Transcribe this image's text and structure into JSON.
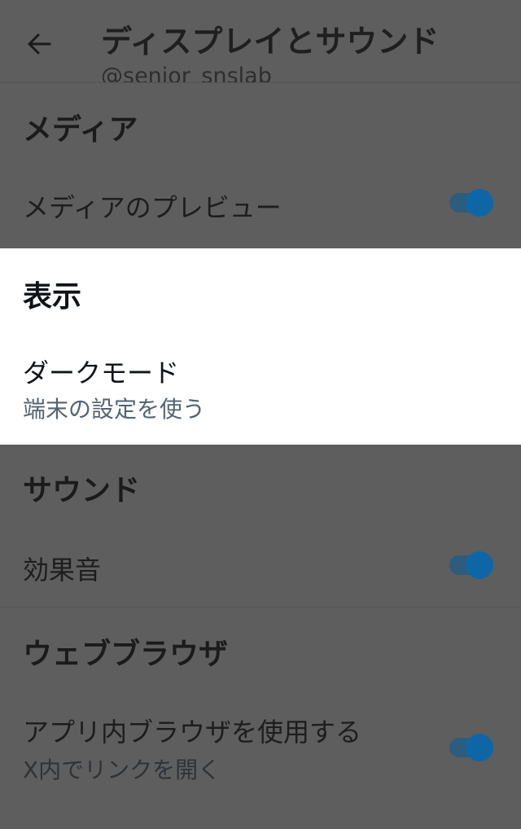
{
  "header": {
    "title": "ディスプレイとサウンド",
    "subtitle": "@senior_snslab"
  },
  "sections": {
    "media": {
      "title": "メディア",
      "preview_label": "メディアのプレビュー",
      "preview_toggle": true
    },
    "display": {
      "title": "表示",
      "dark_mode_label": "ダークモード",
      "dark_mode_value": "端末の設定を使う"
    },
    "sound": {
      "title": "サウンド",
      "effects_label": "効果音",
      "effects_toggle": true
    },
    "browser": {
      "title": "ウェブブラウザ",
      "inapp_label": "アプリ内ブラウザを使用する",
      "inapp_sub": "X内でリンクを開く",
      "inapp_toggle": true
    }
  },
  "colors": {
    "dim_overlay": "#5e5e5e",
    "toggle_knob": "#0f66a6",
    "toggle_track": "#2d5c7d",
    "highlight_bg": "#ffffff",
    "secondary_text": "#536471"
  },
  "icons": {
    "back": "arrow-left-icon"
  }
}
